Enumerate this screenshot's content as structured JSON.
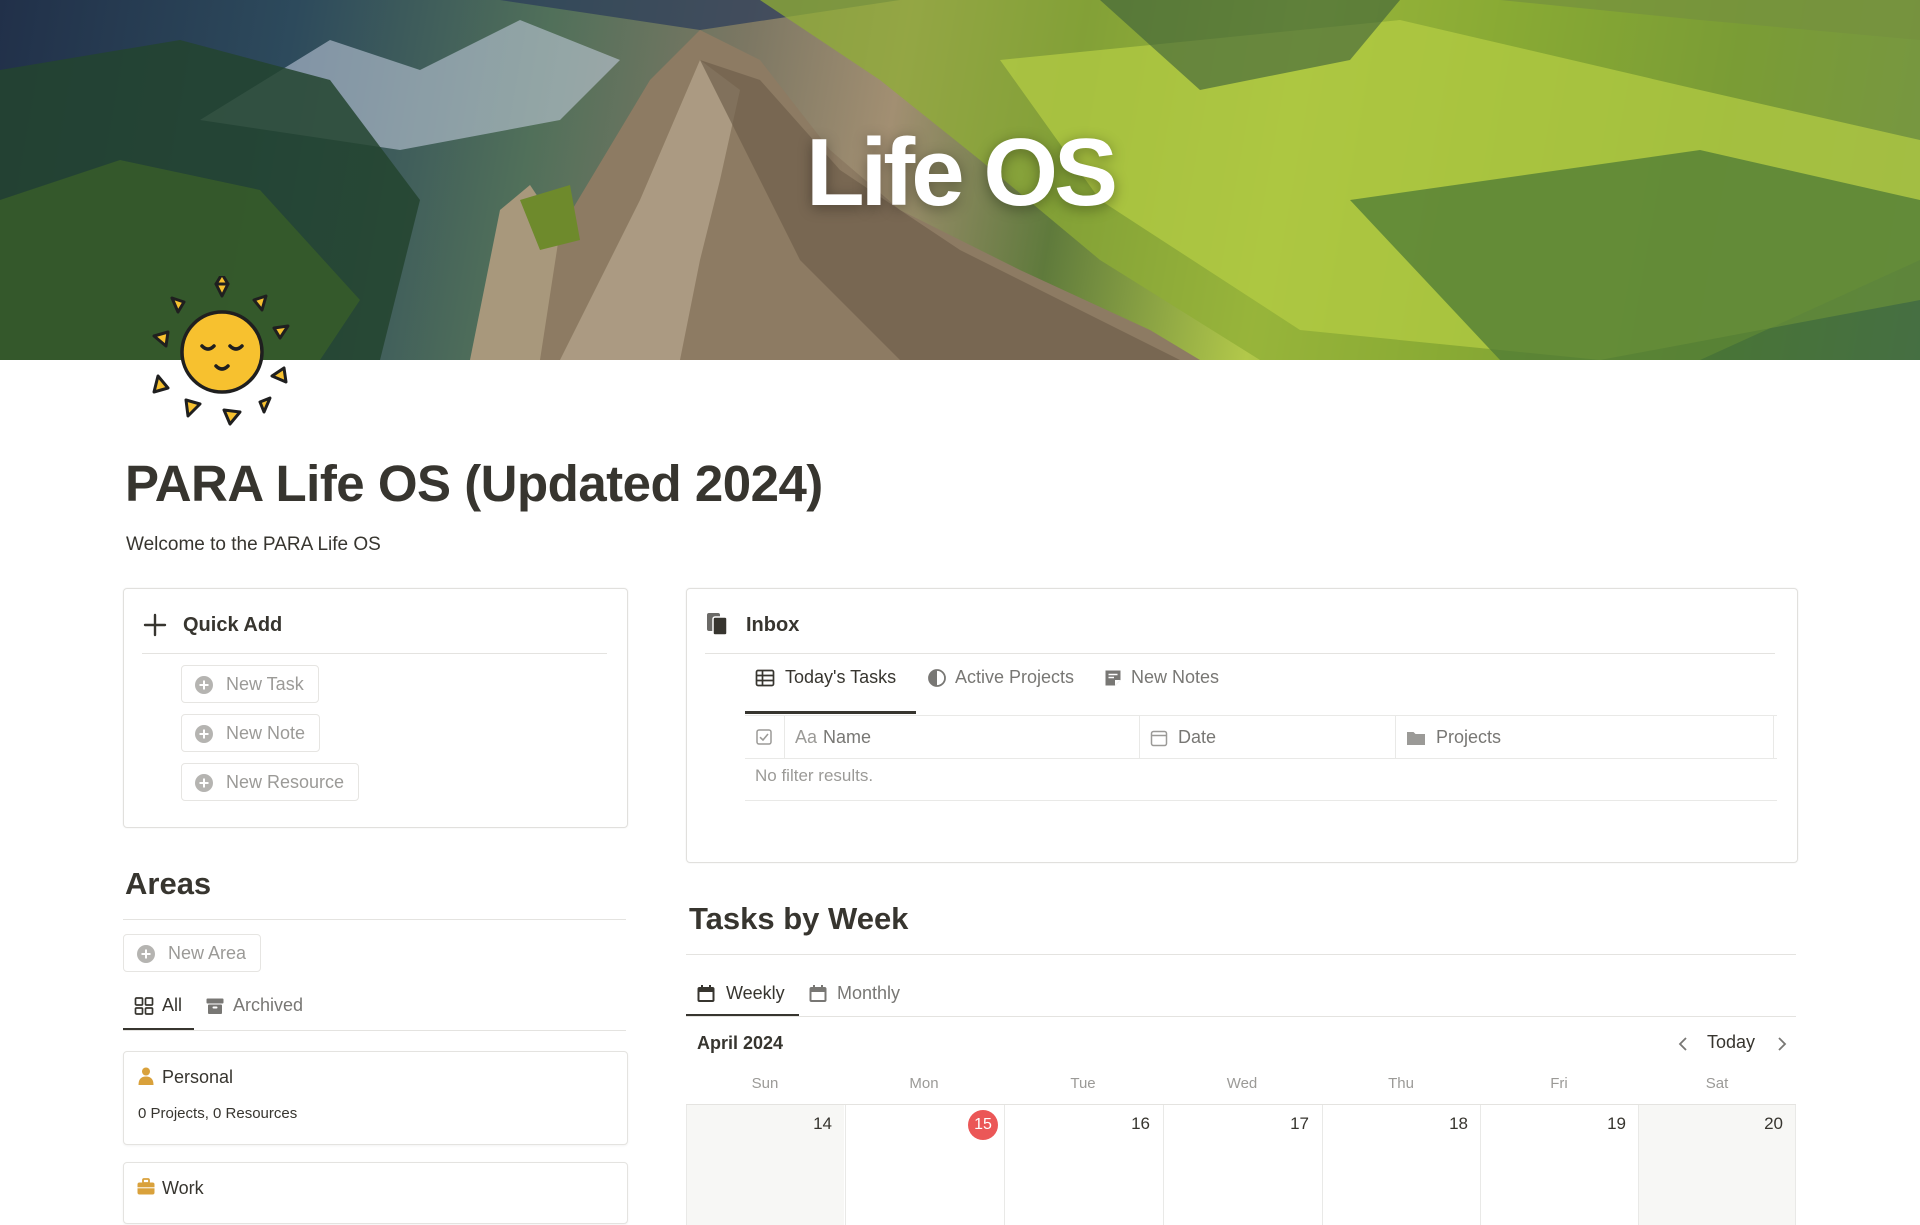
{
  "cover": {
    "title": "Life OS"
  },
  "page": {
    "title": "PARA Life OS (Updated 2024)",
    "subtitle": "Welcome to the PARA Life OS"
  },
  "quick_add": {
    "title": "Quick Add",
    "buttons": [
      "New Task",
      "New Note",
      "New Resource"
    ]
  },
  "areas": {
    "heading": "Areas",
    "new_button": "New Area",
    "tabs": [
      "All",
      "Archived"
    ],
    "cards": [
      {
        "title": "Personal",
        "icon": "person-icon",
        "icon_color": "#d9a13b",
        "meta": "0 Projects, 0 Resources"
      },
      {
        "title": "Work",
        "icon": "briefcase-icon",
        "icon_color": "#d9a13b"
      }
    ]
  },
  "inbox": {
    "title": "Inbox",
    "tabs": [
      "Today's Tasks",
      "Active Projects",
      "New Notes"
    ],
    "columns": [
      "Name",
      "Date",
      "Projects"
    ],
    "name_prefix": "Aa",
    "empty_text": "No filter results."
  },
  "tasks_by_week": {
    "heading": "Tasks by Week",
    "tabs": [
      "Weekly",
      "Monthly"
    ],
    "month_label": "April 2024",
    "today_label": "Today",
    "weekdays": [
      "Sun",
      "Mon",
      "Tue",
      "Wed",
      "Thu",
      "Fri",
      "Sat"
    ],
    "days": [
      "14",
      "15",
      "16",
      "17",
      "18",
      "19",
      "20"
    ],
    "today_day": "15",
    "today_color": "#eb5757"
  },
  "colors": {
    "text": "#37352f",
    "muted": "#9b9a97",
    "border": "#e4e3e0",
    "sun_yellow": "#f7c12f"
  }
}
